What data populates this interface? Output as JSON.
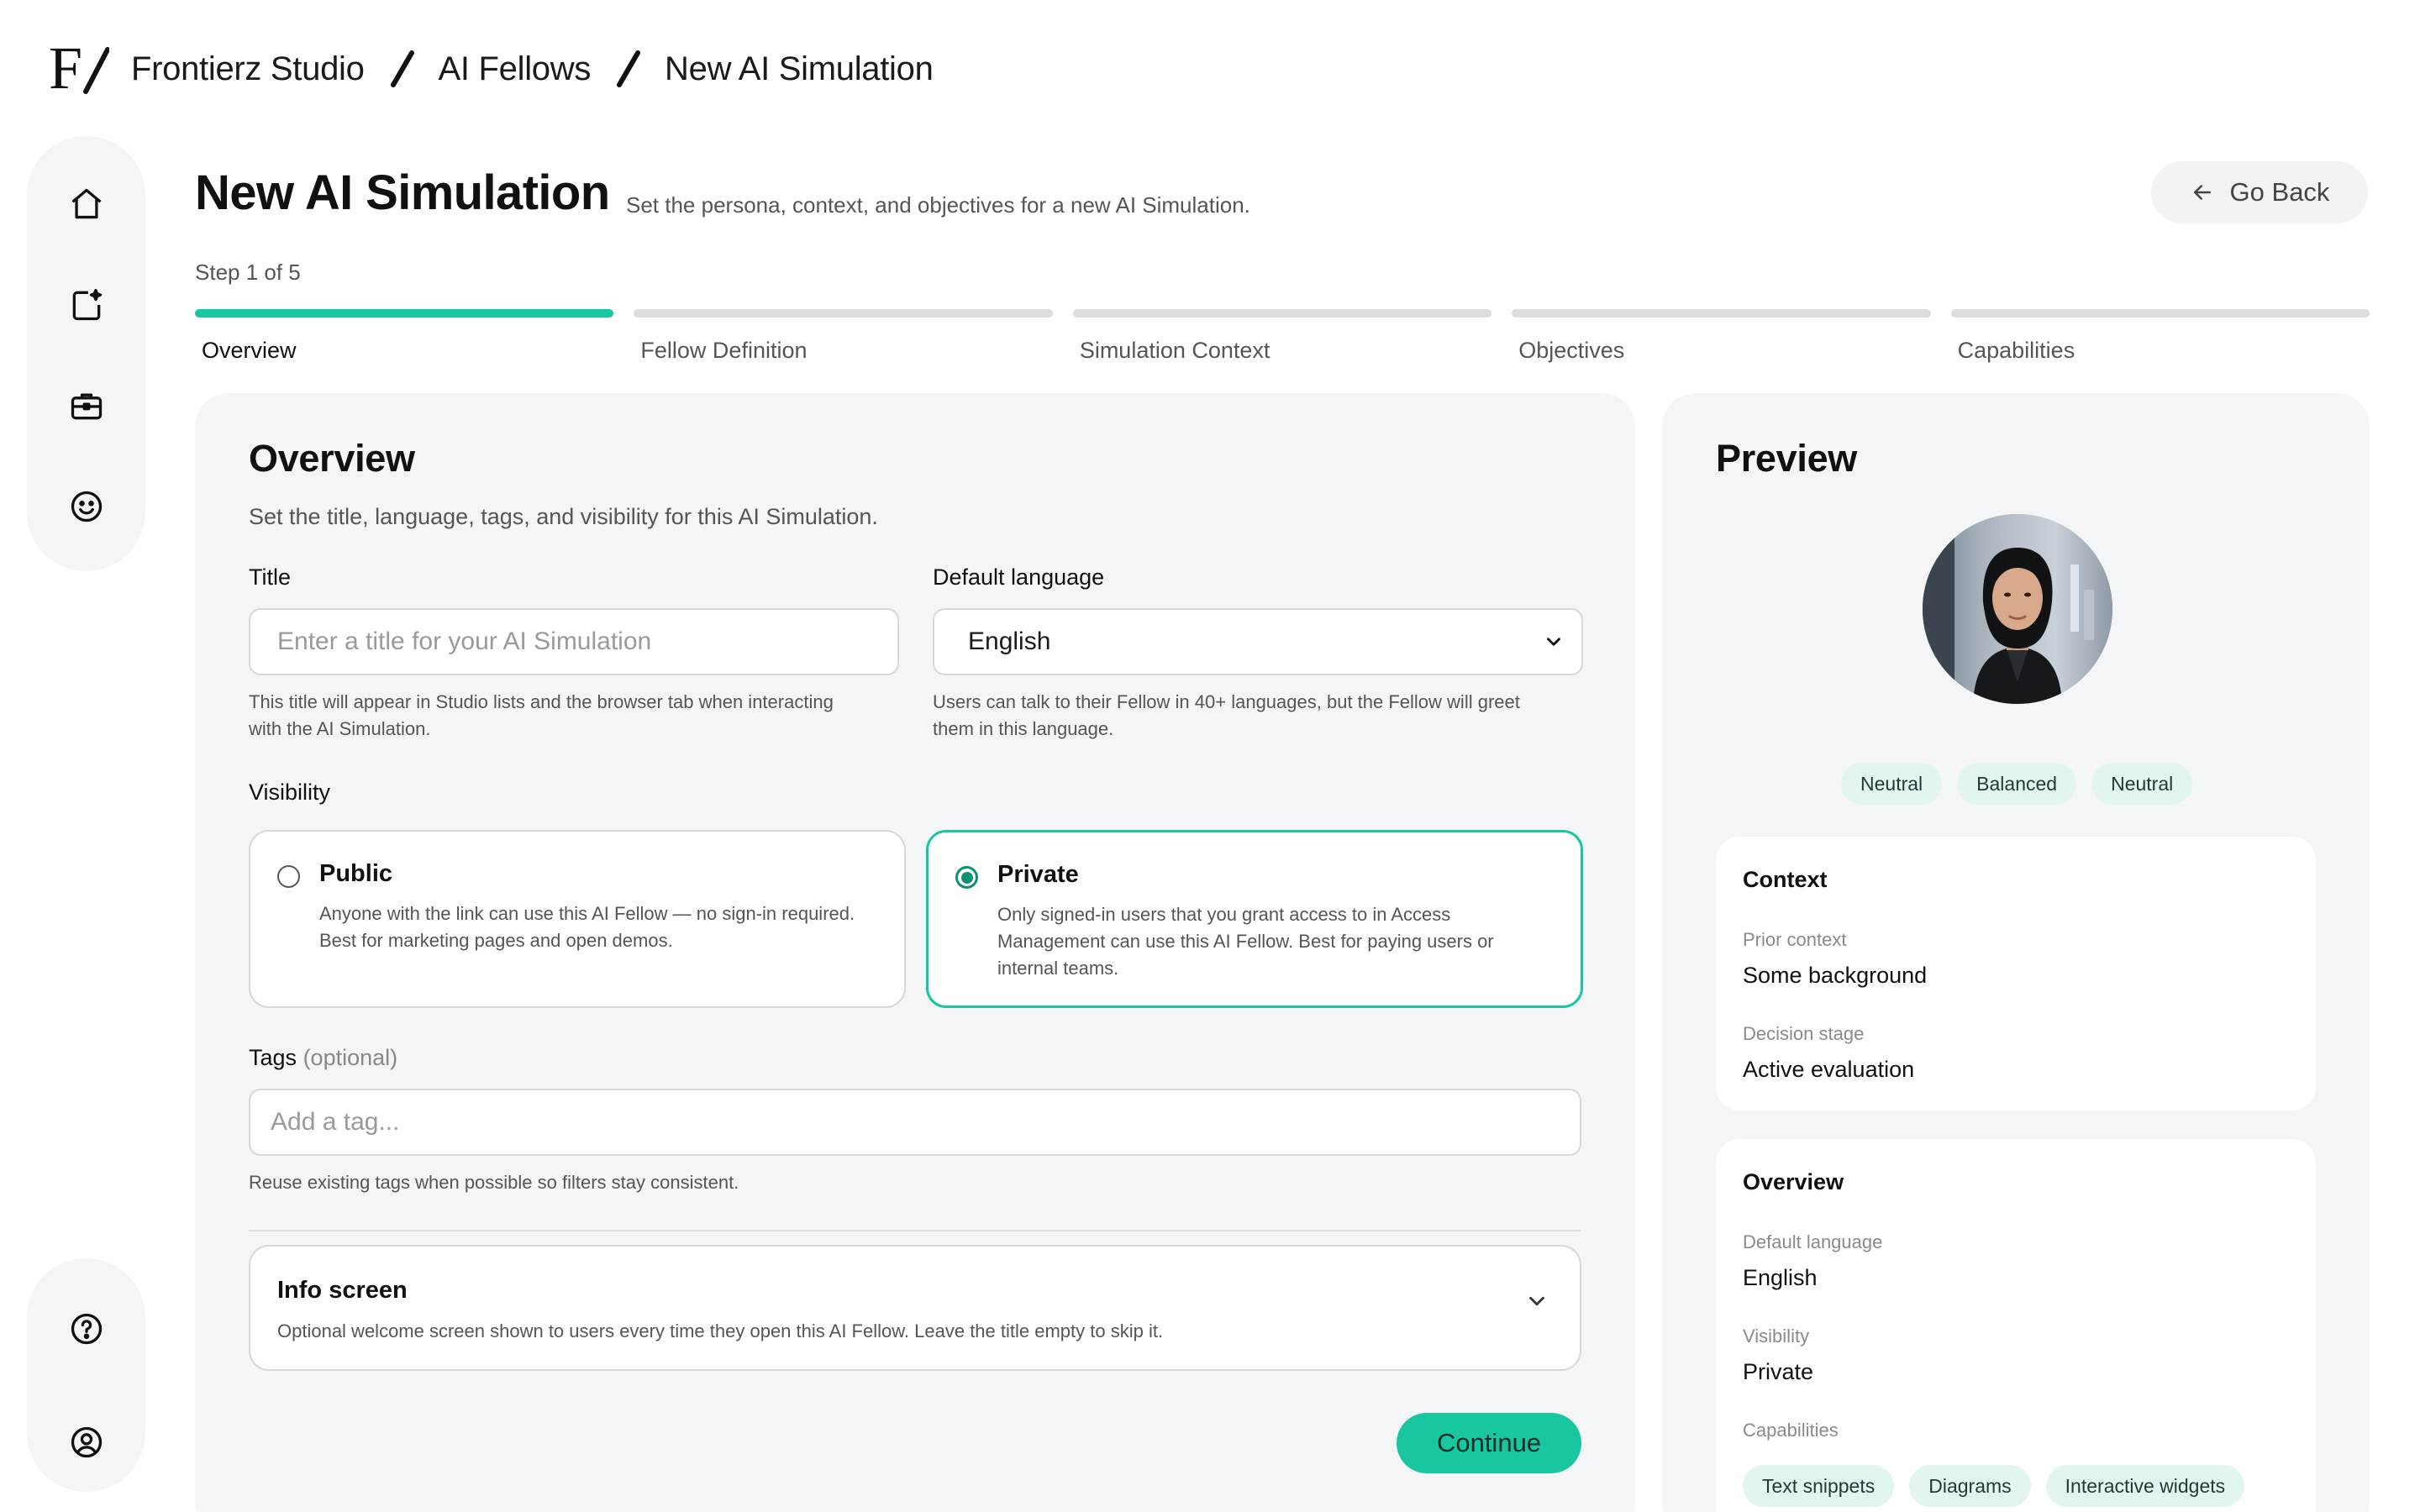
{
  "breadcrumb": {
    "logo_text": "F/",
    "items": [
      "Frontierz Studio",
      "AI Fellows",
      "New AI Simulation"
    ]
  },
  "sidebar": {
    "top_icons": [
      "home-icon",
      "new-fellow-icon",
      "briefcase-icon",
      "smiley-icon"
    ],
    "bottom_icons": [
      "help-icon",
      "account-icon"
    ]
  },
  "header": {
    "title": "New AI Simulation",
    "subtitle": "Set the persona, context, and objectives for a new AI Simulation.",
    "go_back": "Go Back"
  },
  "stepper": {
    "label": "Step 1 of 5",
    "current": 1,
    "total": 5,
    "steps": [
      "Overview",
      "Fellow Definition",
      "Simulation Context",
      "Objectives",
      "Capabilities"
    ]
  },
  "form": {
    "title": "Overview",
    "description": "Set the title, language, tags, and visibility for this AI Simulation.",
    "title_field": {
      "label": "Title",
      "value": "",
      "placeholder": "Enter a title for your AI Simulation",
      "help_line1": "This title will appear in Studio lists and the browser tab when interacting",
      "help_line2": "with the AI Simulation."
    },
    "language_field": {
      "label": "Default language",
      "value": "English",
      "help_line1": "Users can talk to their Fellow in 40+ languages, but the Fellow will greet",
      "help_line2": "them in this language."
    },
    "visibility": {
      "label": "Visibility",
      "selected": "Private",
      "public": {
        "title": "Public",
        "line1": "Anyone with the link can use this AI Fellow — no sign-in required.",
        "line2": "Best for marketing pages and open demos."
      },
      "private": {
        "title": "Private",
        "line1": "Only signed-in users that you grant access to in Access",
        "line2": "Management can use this AI Fellow. Best for paying users or",
        "line3": "internal teams."
      }
    },
    "tags": {
      "label": "Tags",
      "optional": "(optional)",
      "value": "",
      "placeholder": "Add a tag...",
      "help": "Reuse existing tags when possible so filters stay consistent."
    },
    "info_screen": {
      "title": "Info screen",
      "description": "Optional welcome screen shown to users every time they open this AI Fellow. Leave the title empty to skip it."
    },
    "continue_label": "Continue"
  },
  "preview": {
    "title": "Preview",
    "traits": [
      "Neutral",
      "Balanced",
      "Neutral"
    ],
    "context": {
      "title": "Context",
      "prior_context_label": "Prior context",
      "prior_context_value": "Some background",
      "decision_stage_label": "Decision stage",
      "decision_stage_value": "Active evaluation"
    },
    "overview": {
      "title": "Overview",
      "language_label": "Default language",
      "language_value": "English",
      "visibility_label": "Visibility",
      "visibility_value": "Private",
      "capabilities_label": "Capabilities",
      "capabilities": [
        "Text snippets",
        "Diagrams",
        "Interactive widgets"
      ]
    }
  },
  "colors": {
    "accent": "#18c7a0",
    "accent_dark": "#0e8f73",
    "panel": "#f4f5f6",
    "chip": "#e2f5ee"
  }
}
